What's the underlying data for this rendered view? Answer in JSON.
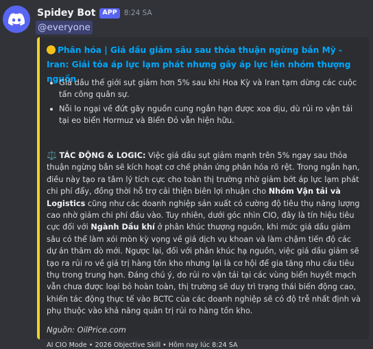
{
  "message": {
    "author": "Spidey Bot",
    "badge": "APP",
    "timestamp": "8:24 SA",
    "mention": "@everyone"
  },
  "embed": {
    "accent_color": "#f0d22c",
    "title_icon": "yellow-circle-icon",
    "title": "Phân hóa | Giá dầu giảm sâu sau thỏa thuận ngừng bắn Mỹ - Iran: Giải tỏa áp lực lạm phát nhưng gây áp lực lên nhóm thượng nguồn",
    "bullets": [
      "Giá dầu thế giới sụt giảm hơn 5% sau khi Hoa Kỳ và Iran tạm dừng các cuộc tấn công quân sự.",
      "Nỗi lo ngại về đứt gãy nguồn cung ngắn hạn được xoa dịu, dù rủi ro vận tải tại eo biển Hormuz và Biển Đỏ vẫn hiện hữu."
    ],
    "body": {
      "icon": "balance-scale-icon",
      "heading": "TÁC ĐỘNG & LOGIC:",
      "text_1": " Việc giá dầu sụt giảm mạnh trên 5% ngay sau thỏa thuận ngừng bắn sẽ kích hoạt cơ chế phản ứng phân hóa rõ rệt. Trong ngắn hạn, điều này tạo ra tâm lý tích cực cho toàn thị trường nhờ giảm bớt áp lực lạm phát chi phí đẩy, đồng thời hỗ trợ cải thiện biên lợi nhuận cho ",
      "bold_1": "Nhóm Vận tải và Logistics",
      "text_2": " cũng như các doanh nghiệp sản xuất có cường độ tiêu thụ năng lượng cao nhờ giảm chi phí đầu vào. Tuy nhiên, dưới góc nhìn CIO, đây là tín hiệu tiêu cực đối với ",
      "bold_2": "Ngành Dầu khí",
      "text_3": " ở phân khúc thượng nguồn, khi mức giá dầu giảm sâu có thể làm xói mòn kỳ vọng về giá dịch vụ khoan và làm chậm tiến độ các dự án thăm dò mới. Ngược lại, đối với phân khúc hạ nguồn, việc giá dầu giảm sẽ tạo ra rủi ro về giá trị hàng tồn kho nhưng lại là cơ hội để gia tăng nhu cầu tiêu thụ trong trung hạn. Đáng chú ý, do rủi ro vận tải tại các vùng biển huyết mạch vẫn chưa được loại bỏ hoàn toàn, thị trường sẽ duy trì trạng thái biến động cao, khiến tác động thực tế vào BCTC của các doanh nghiệp sẽ có độ trễ nhất định và phụ thuộc vào khả năng quản trị rủi ro hàng tồn kho."
    },
    "source": "Nguồn: OilPrice.com",
    "footer": "AI CIO Mode • 2026 Objective Skill • Hôm nay lúc 8:24 SA"
  }
}
